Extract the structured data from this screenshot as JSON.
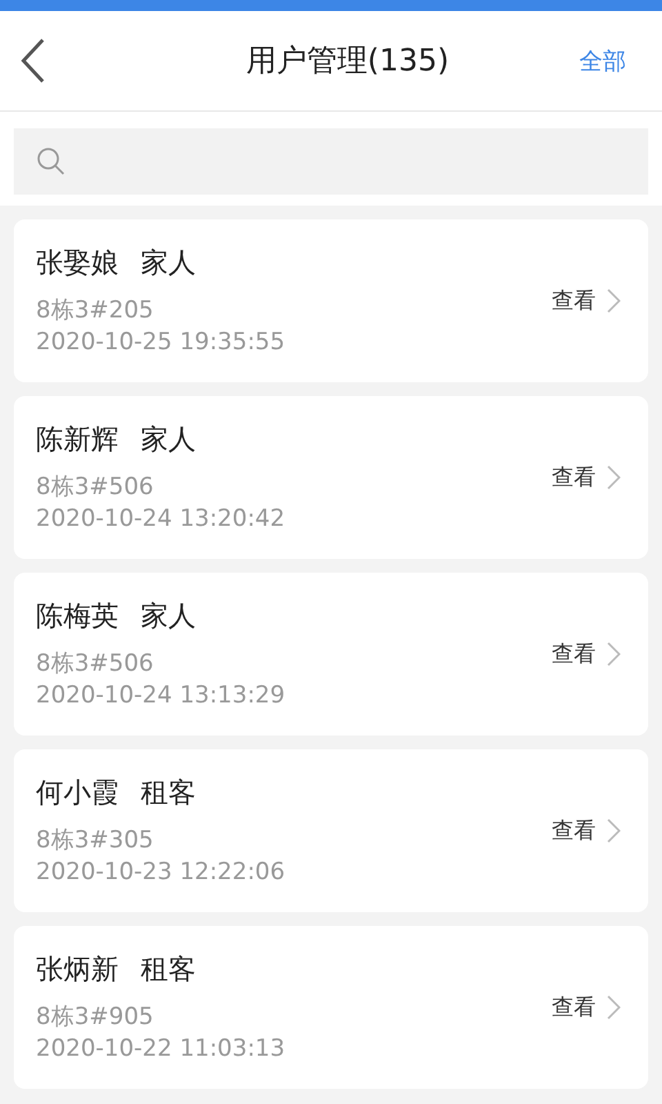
{
  "header": {
    "title": "用户管理(135)",
    "action": "全部"
  },
  "users": [
    {
      "name": "张娶娘",
      "role": "家人",
      "unit": "8栋3#205",
      "time": "2020-10-25 19:35:55",
      "link": "查看"
    },
    {
      "name": "陈新辉",
      "role": "家人",
      "unit": "8栋3#506",
      "time": "2020-10-24 13:20:42",
      "link": "查看"
    },
    {
      "name": "陈梅英",
      "role": "家人",
      "unit": "8栋3#506",
      "time": "2020-10-24 13:13:29",
      "link": "查看"
    },
    {
      "name": "何小霞",
      "role": "租客",
      "unit": "8栋3#305",
      "time": "2020-10-23 12:22:06",
      "link": "查看"
    },
    {
      "name": "张炳新",
      "role": "租客",
      "unit": "8栋3#905",
      "time": "2020-10-22 11:03:13",
      "link": "查看"
    }
  ]
}
